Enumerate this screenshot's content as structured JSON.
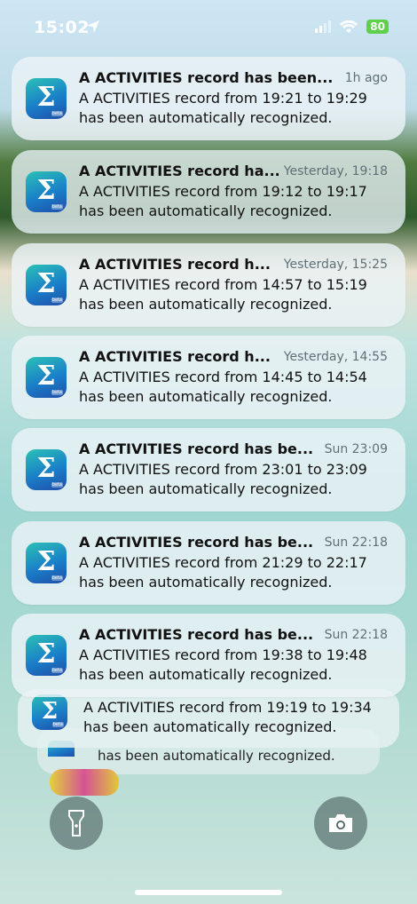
{
  "status_bar": {
    "time": "15:02",
    "battery": "80"
  },
  "notifications": [
    {
      "title": "A ACTIVITIES record has been...",
      "time": "1h ago",
      "body": "A ACTIVITIES record from 19:21 to 19:29 has been automatically recognized."
    },
    {
      "title": "A ACTIVITIES record ha...",
      "time": "Yesterday, 19:18",
      "body": "A ACTIVITIES record from 19:12 to 19:17 has been automatically recognized."
    },
    {
      "title": "A ACTIVITIES record h...",
      "time": "Yesterday, 15:25",
      "body": "A ACTIVITIES record from 14:57 to 15:19 has been automatically recognized."
    },
    {
      "title": "A ACTIVITIES record h...",
      "time": "Yesterday, 14:55",
      "body": "A ACTIVITIES record from 14:45 to 14:54 has been automatically recognized."
    },
    {
      "title": "A ACTIVITIES record has be...",
      "time": "Sun 23:09",
      "body": "A ACTIVITIES record from 23:01 to 23:09 has been automatically recognized."
    },
    {
      "title": "A ACTIVITIES record has be...",
      "time": "Sun 22:18",
      "body": "A ACTIVITIES record from 21:29 to 22:17 has been automatically recognized."
    },
    {
      "title": "A ACTIVITIES record has be...",
      "time": "Sun 22:18",
      "body": "A ACTIVITIES record from 19:38 to 19:48 has been automatically recognized."
    }
  ],
  "stacked": [
    {
      "body": "A ACTIVITIES record from 19:19 to 19:34 has been automatically recognized."
    },
    {
      "body": "has been automatically recognized."
    }
  ],
  "app_icon": {
    "name": "sigma-app-icon",
    "glyph": "Σ",
    "badge": "beta",
    "colors": [
      "#2bc1b5",
      "#1a7fc9",
      "#1f4ea8"
    ]
  },
  "controls": {
    "flashlight_icon": "flashlight-icon",
    "camera_icon": "camera-icon"
  }
}
